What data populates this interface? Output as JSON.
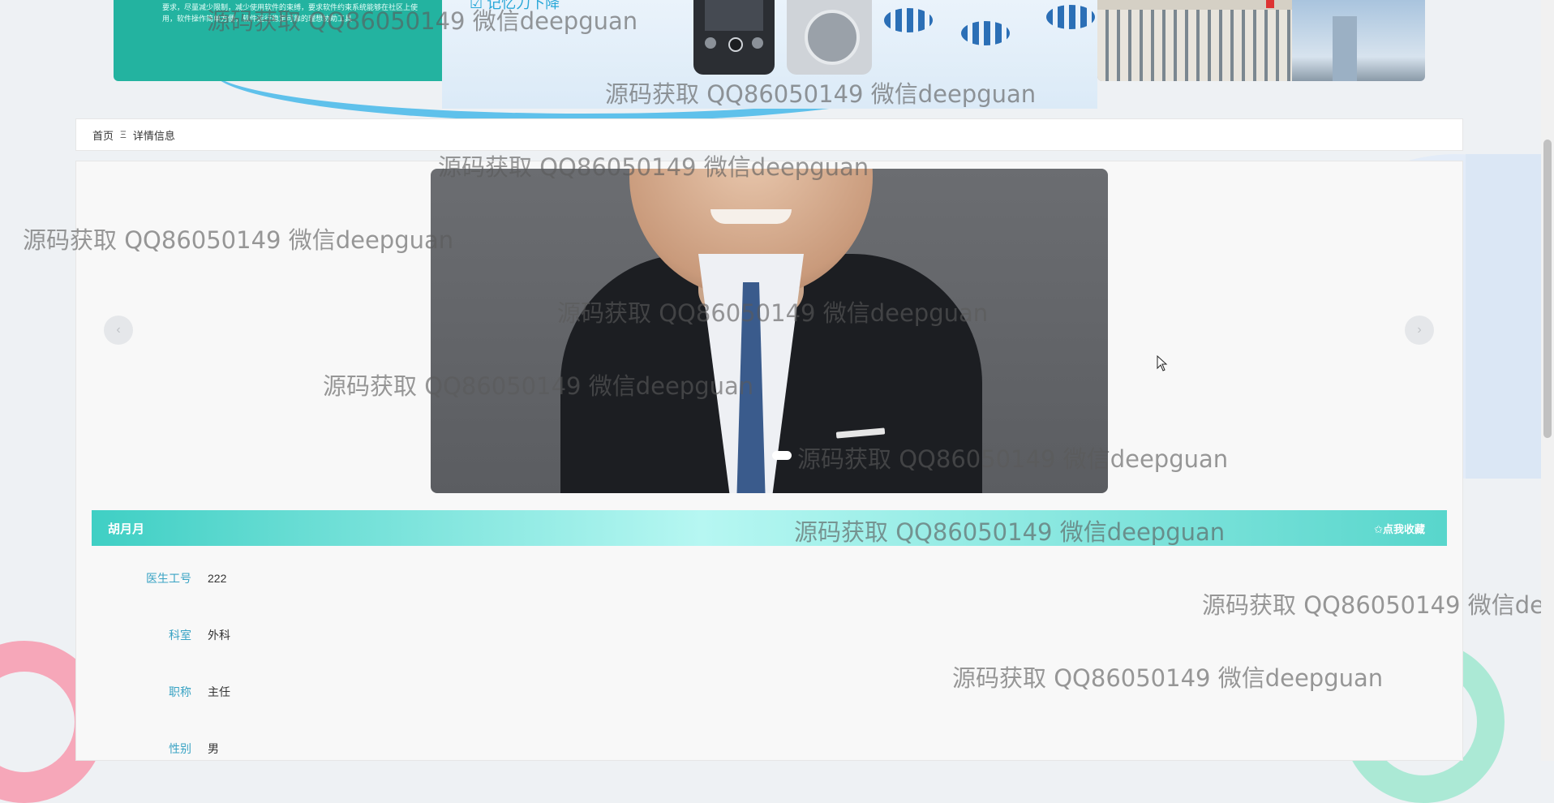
{
  "banner": {
    "left_text": "要求，尽量减少限制，减少使用软件的束缚，要求软件约束系统能够在社区上使用，软件操作简单方便，软件运行稳定可靠的理想协助工具",
    "center_check_text": "☑ 记忆力下降"
  },
  "breadcrumb": {
    "home": "首页",
    "separator": "Ξ",
    "current": "详情信息"
  },
  "carousel": {
    "prev_icon": "‹",
    "next_icon": "›",
    "active_index": 0
  },
  "detail": {
    "name": "胡月月",
    "favorite_label": "✩点我收藏",
    "fields": [
      {
        "label": "医生工号",
        "value": "222"
      },
      {
        "label": "科室",
        "value": "外科"
      },
      {
        "label": "职称",
        "value": "主任"
      },
      {
        "label": "性别",
        "value": "男"
      }
    ]
  },
  "watermark": {
    "text": "源码获取 QQ86050149 微信deepguan"
  },
  "colors": {
    "accent": "#3fcfc4",
    "label": "#3aa3c4",
    "banner_green": "#23b3a0"
  }
}
